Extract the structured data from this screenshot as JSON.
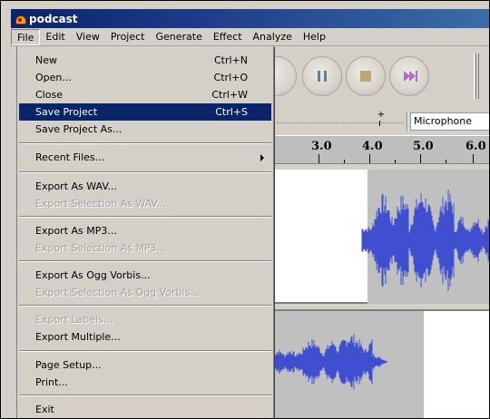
{
  "window": {
    "title": "podcast"
  },
  "menubar": [
    "File",
    "Edit",
    "View",
    "Project",
    "Generate",
    "Effect",
    "Analyze",
    "Help"
  ],
  "file_menu": {
    "items": [
      {
        "label": "New",
        "shortcut": "Ctrl+N",
        "enabled": true
      },
      {
        "label": "Open...",
        "shortcut": "Ctrl+O",
        "enabled": true
      },
      {
        "label": "Close",
        "shortcut": "Ctrl+W",
        "enabled": true
      },
      {
        "label": "Save Project",
        "shortcut": "Ctrl+S",
        "enabled": true,
        "highlighted": true
      },
      {
        "label": "Save Project As...",
        "shortcut": "",
        "enabled": true
      },
      {
        "label": "Recent Files...",
        "shortcut": "",
        "enabled": true,
        "submenu": true
      },
      {
        "label": "Export As WAV...",
        "shortcut": "",
        "enabled": true
      },
      {
        "label": "Export Selection As WAV...",
        "shortcut": "",
        "enabled": false
      },
      {
        "label": "Export As MP3...",
        "shortcut": "",
        "enabled": true
      },
      {
        "label": "Export Selection As MP3...",
        "shortcut": "",
        "enabled": false
      },
      {
        "label": "Export As Ogg Vorbis...",
        "shortcut": "",
        "enabled": true
      },
      {
        "label": "Export Selection As Ogg Vorbis...",
        "shortcut": "",
        "enabled": false
      },
      {
        "label": "Export Labels...",
        "shortcut": "",
        "enabled": false
      },
      {
        "label": "Export Multiple...",
        "shortcut": "",
        "enabled": true
      },
      {
        "label": "Page Setup...",
        "shortcut": "",
        "enabled": true
      },
      {
        "label": "Print...",
        "shortcut": "",
        "enabled": true
      },
      {
        "label": "Exit",
        "shortcut": "",
        "enabled": true
      }
    ]
  },
  "toolbar": {
    "buttons": [
      "pause-icon",
      "stop-icon",
      "skip-to-end-icon"
    ]
  },
  "input": {
    "device": "Microphone",
    "slider_marker": "+"
  },
  "ruler": {
    "labels": [
      "3.0",
      "4.0",
      "5.0",
      "6.0"
    ]
  },
  "colors": {
    "waveform": "#3f4fcf",
    "selection": "#c0c0c0",
    "menu_highlight": "#0a246a"
  }
}
